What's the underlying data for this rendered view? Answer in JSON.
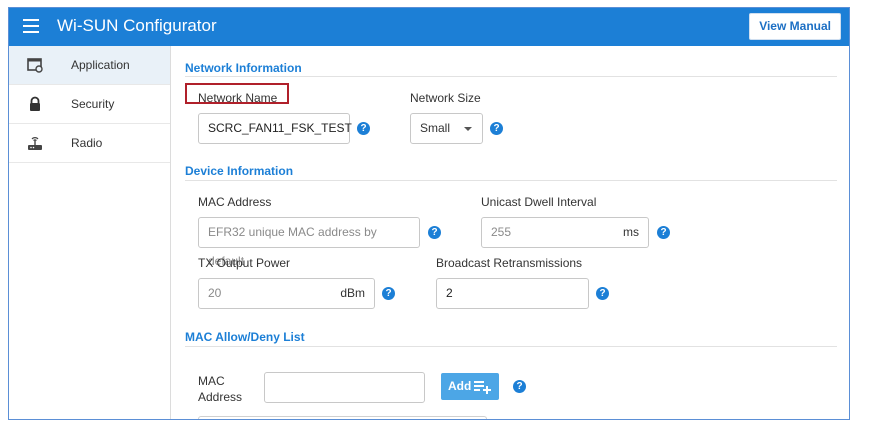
{
  "header": {
    "title": "Wi-SUN Configurator",
    "view_manual_label": "View Manual"
  },
  "sidebar": {
    "items": [
      {
        "label": "Application",
        "icon": "application-icon",
        "active": true
      },
      {
        "label": "Security",
        "icon": "lock-icon",
        "active": false
      },
      {
        "label": "Radio",
        "icon": "router-icon",
        "active": false
      }
    ]
  },
  "network_info": {
    "title": "Network Information",
    "network_name": {
      "label": "Network Name",
      "value": "SCRC_FAN11_FSK_TEST"
    },
    "network_size": {
      "label": "Network Size",
      "value": "Small"
    }
  },
  "device_info": {
    "title": "Device Information",
    "mac_address": {
      "label": "MAC Address",
      "placeholder": "EFR32 unique MAC address by default"
    },
    "unicast_dwell": {
      "label": "Unicast Dwell Interval",
      "value": "255",
      "unit": "ms"
    },
    "tx_power": {
      "label": "TX Output Power",
      "value": "20",
      "unit": "dBm"
    },
    "broadcast_retrans": {
      "label": "Broadcast Retransmissions",
      "value": "2"
    }
  },
  "mac_list": {
    "title": "MAC Allow/Deny List",
    "mac_label_line1": "MAC",
    "mac_label_line2": "Address",
    "add_label": "Add"
  },
  "help_glyph": "?",
  "colors": {
    "accent": "#1c7fd6",
    "highlight": "#b0202a"
  }
}
